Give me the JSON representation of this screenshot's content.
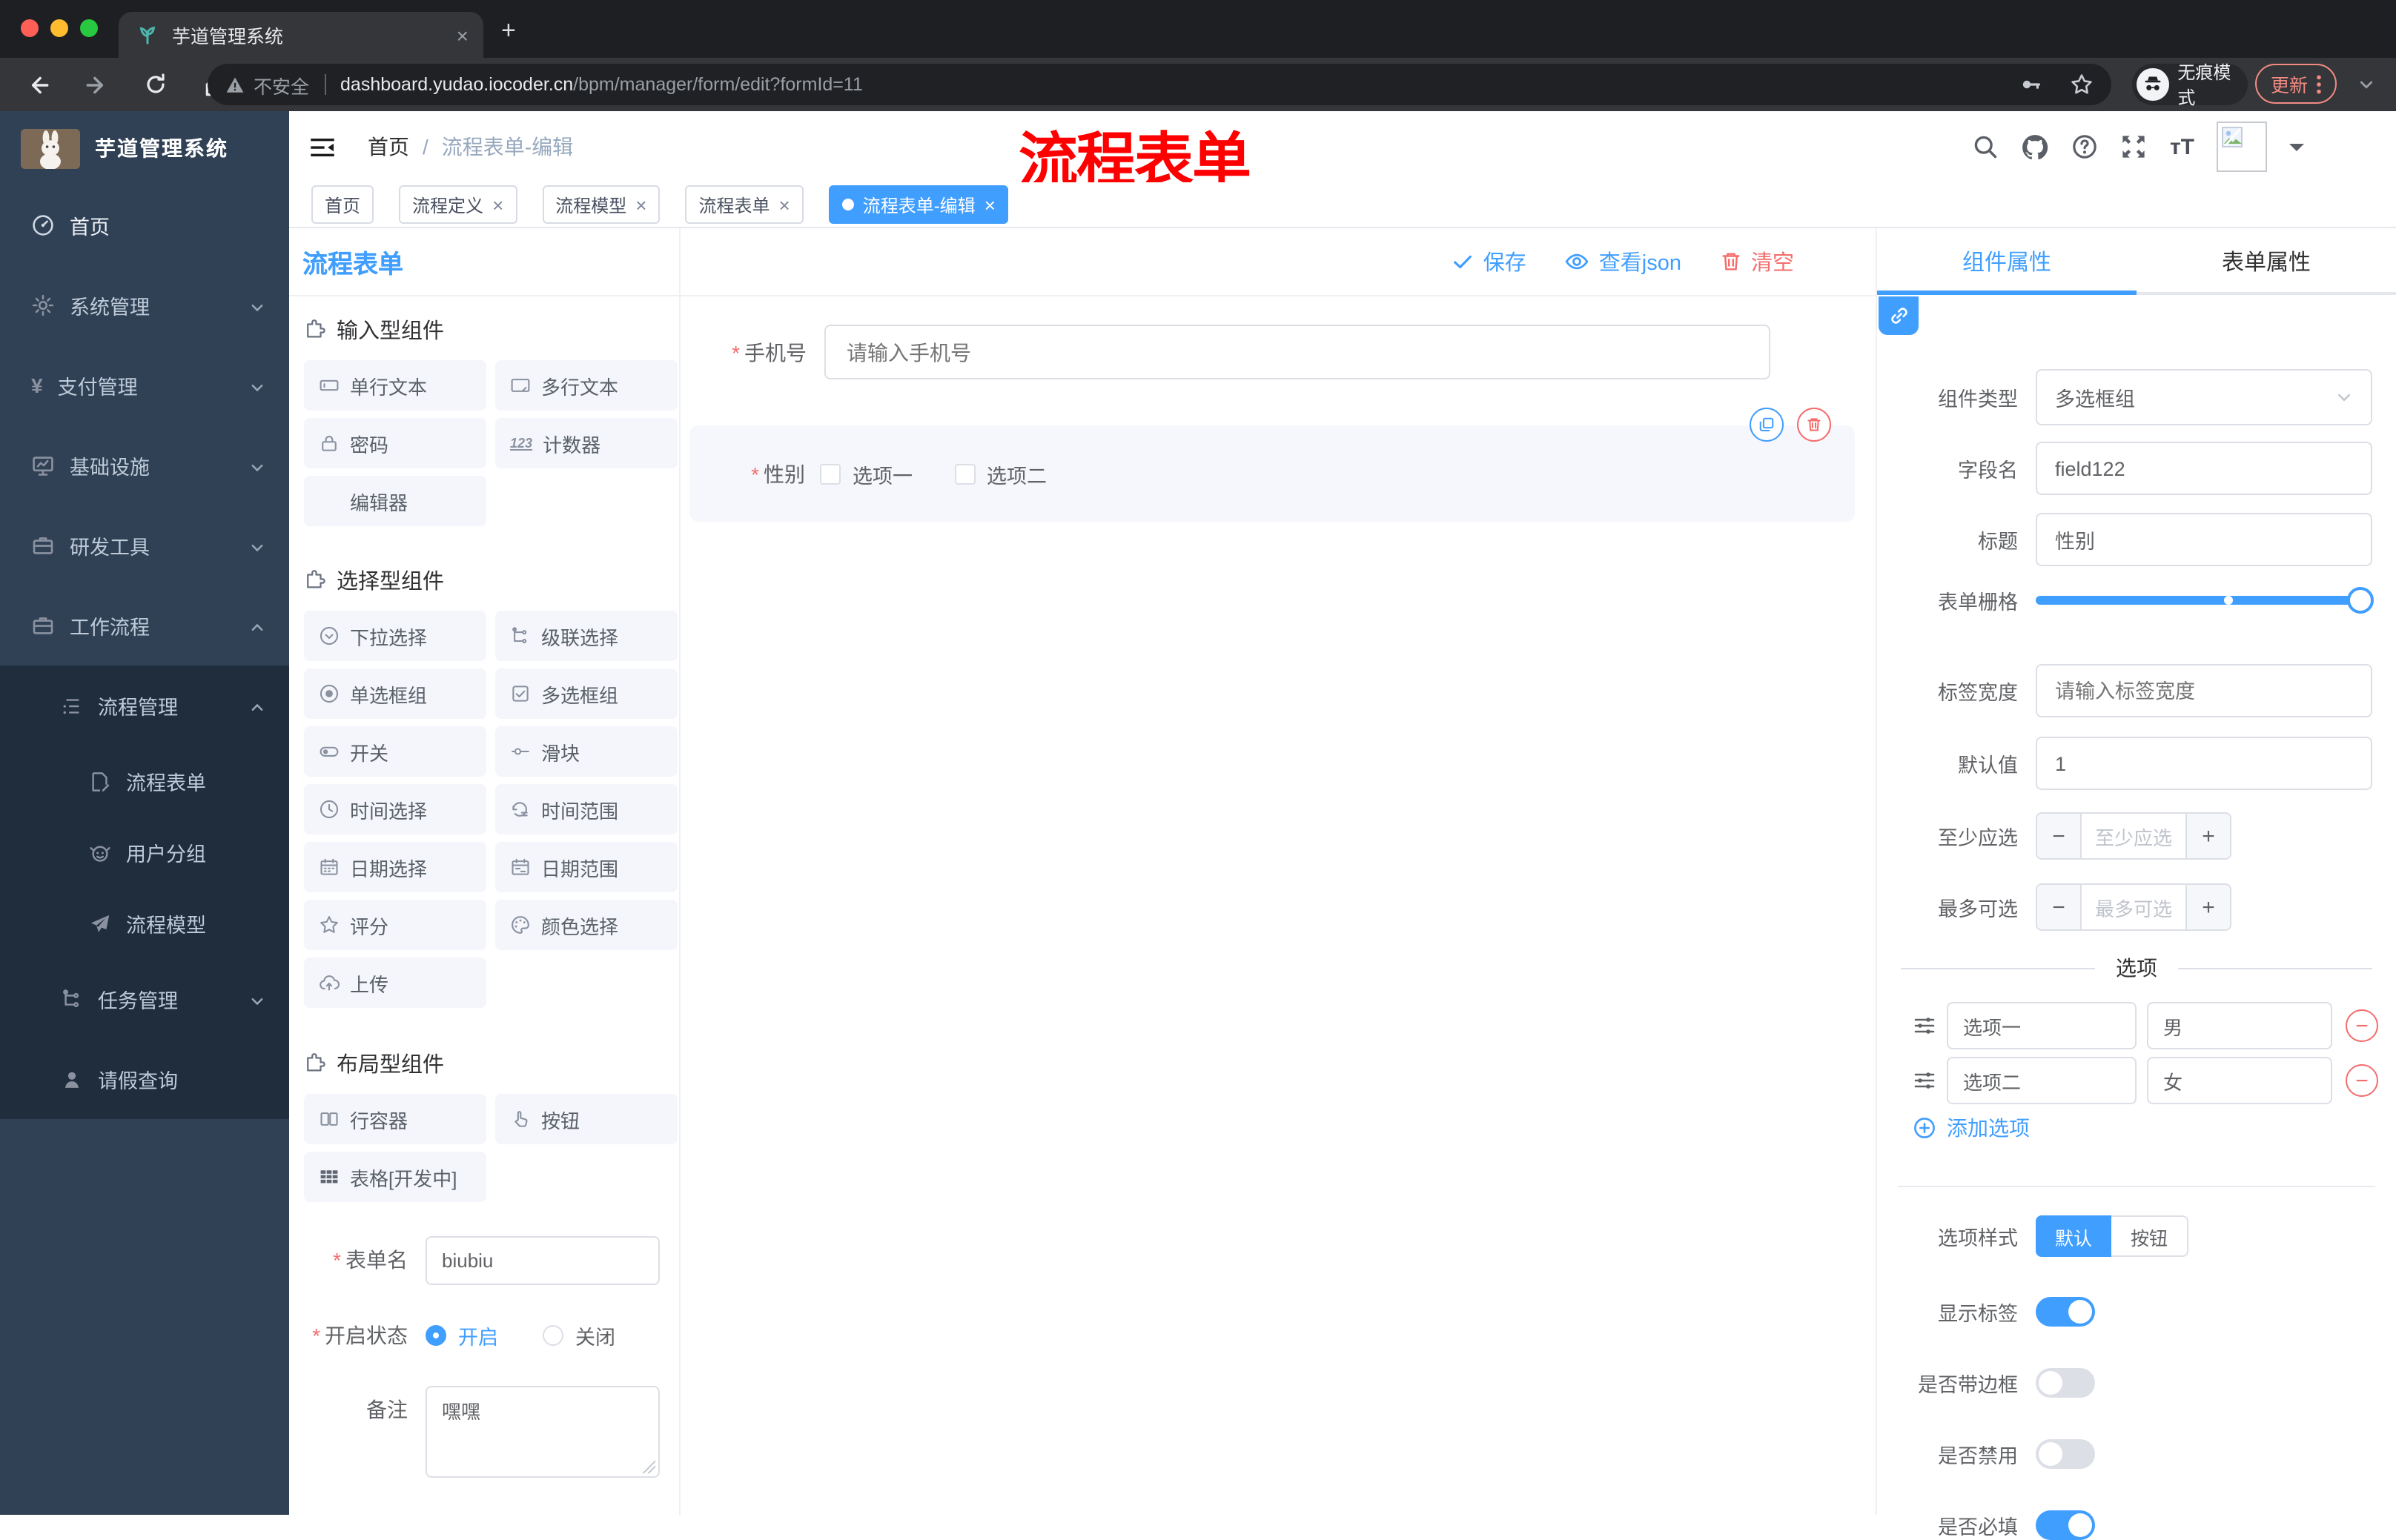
{
  "browser": {
    "tab_title": "芋道管理系统",
    "security": "不安全",
    "url_host": "dashboard.yudao.iocoder.cn",
    "url_path": "/bpm/manager/form/edit?formId=11",
    "incognito": "无痕模式",
    "update": "更新"
  },
  "header": {
    "breadcrumb_home": "首页",
    "breadcrumb_sep": "/",
    "breadcrumb_page": "流程表单-编辑",
    "annotation": "流程表单"
  },
  "sidebar": {
    "brand": "芋道管理系统",
    "items": [
      {
        "label": "首页"
      },
      {
        "label": "系统管理"
      },
      {
        "label": "支付管理"
      },
      {
        "label": "基础设施"
      },
      {
        "label": "研发工具"
      },
      {
        "label": "工作流程"
      },
      {
        "label": "流程管理"
      },
      {
        "label": "流程表单"
      },
      {
        "label": "用户分组"
      },
      {
        "label": "流程模型"
      },
      {
        "label": "任务管理"
      },
      {
        "label": "请假查询"
      }
    ]
  },
  "tags": {
    "items": [
      {
        "label": "首页"
      },
      {
        "label": "流程定义"
      },
      {
        "label": "流程模型"
      },
      {
        "label": "流程表单"
      },
      {
        "label": "流程表单-编辑"
      }
    ]
  },
  "toolbar": {
    "save": "保存",
    "view_json": "查看json",
    "clear": "清空"
  },
  "palette": {
    "title": "流程表单",
    "sections": [
      {
        "title": "输入型组件",
        "items": [
          {
            "label": "单行文本"
          },
          {
            "label": "多行文本"
          },
          {
            "label": "密码"
          },
          {
            "label": "计数器"
          },
          {
            "label": "编辑器"
          }
        ]
      },
      {
        "title": "选择型组件",
        "items": [
          {
            "label": "下拉选择"
          },
          {
            "label": "级联选择"
          },
          {
            "label": "单选框组"
          },
          {
            "label": "多选框组"
          },
          {
            "label": "开关"
          },
          {
            "label": "滑块"
          },
          {
            "label": "时间选择"
          },
          {
            "label": "时间范围"
          },
          {
            "label": "日期选择"
          },
          {
            "label": "日期范围"
          },
          {
            "label": "评分"
          },
          {
            "label": "颜色选择"
          },
          {
            "label": "上传"
          }
        ]
      },
      {
        "title": "布局型组件",
        "items": [
          {
            "label": "行容器"
          },
          {
            "label": "按钮"
          },
          {
            "label": "表格[开发中]"
          }
        ]
      }
    ],
    "form": {
      "name_label": "表单名",
      "name_value": "biubiu",
      "status_label": "开启状态",
      "status_on": "开启",
      "status_off": "关闭",
      "remark_label": "备注",
      "remark_value": "嘿嘿"
    }
  },
  "canvas": {
    "phone_label": "手机号",
    "phone_placeholder": "请输入手机号",
    "gender_label": "性别",
    "gender_opt1": "选项一",
    "gender_opt2": "选项二"
  },
  "panel": {
    "tab_component": "组件属性",
    "tab_form": "表单属性",
    "type_label": "组件类型",
    "type_value": "多选框组",
    "field_label": "字段名",
    "field_value": "field122",
    "title_label": "标题",
    "title_value": "性别",
    "grid_label": "表单栅格",
    "label_width_label": "标签宽度",
    "label_width_placeholder": "请输入标签宽度",
    "default_label": "默认值",
    "default_value": "1",
    "min_label": "至少应选",
    "min_placeholder": "至少应选",
    "max_label": "最多可选",
    "max_placeholder": "最多可选",
    "options_title": "选项",
    "options": [
      {
        "label": "选项一",
        "value": "男"
      },
      {
        "label": "选项二",
        "value": "女"
      }
    ],
    "add_option": "添加选项",
    "style_label": "选项样式",
    "style_default": "默认",
    "style_button": "按钮",
    "show_label_label": "显示标签",
    "border_label": "是否带边框",
    "disabled_label": "是否禁用",
    "required_label": "是否必填"
  },
  "colors": {
    "primary": "#409EFF",
    "danger": "#F56C6C",
    "sidebar": "#304156",
    "submenu": "#1F2D3D",
    "annotation": "#FE0000"
  }
}
